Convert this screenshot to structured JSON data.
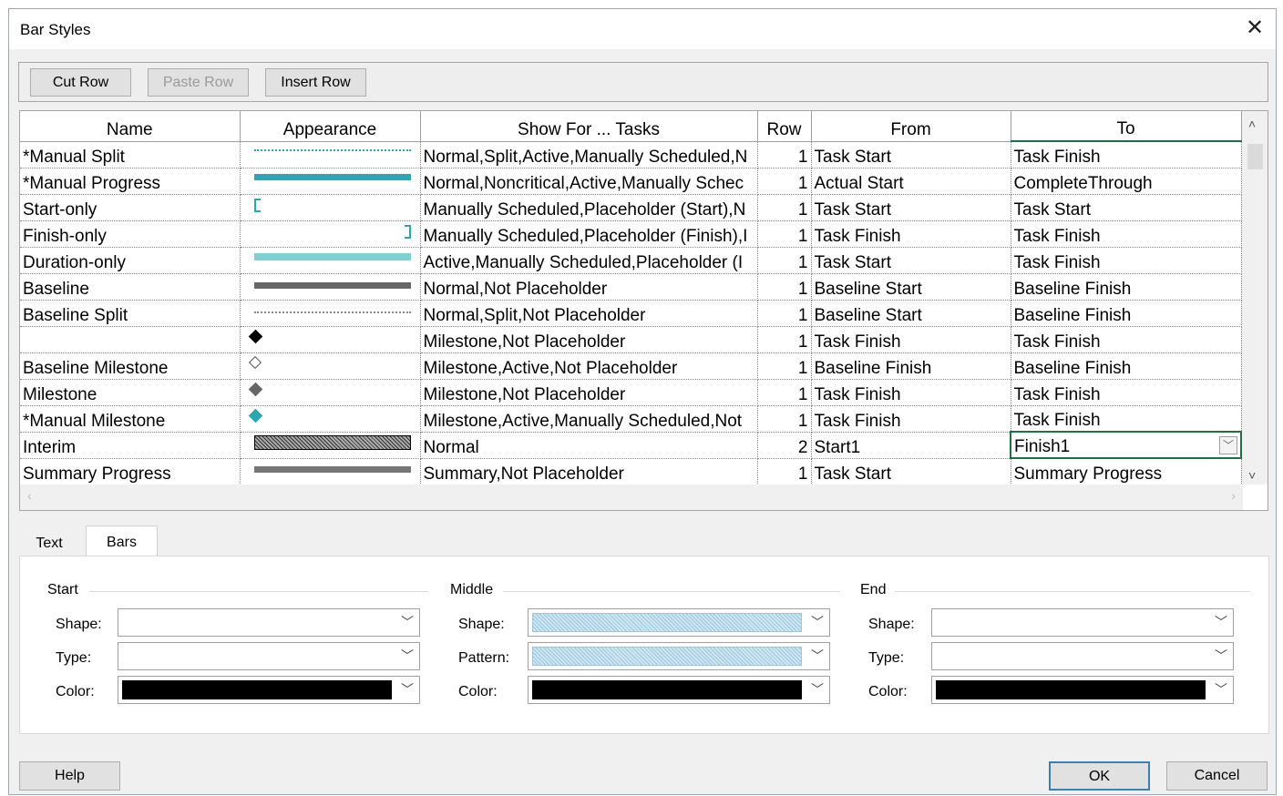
{
  "dialog": {
    "title": "Bar Styles"
  },
  "toolbar": {
    "cut": "Cut Row",
    "paste": "Paste Row",
    "insert": "Insert Row"
  },
  "columns": [
    "Name",
    "Appearance",
    "Show For ... Tasks",
    "Row",
    "From",
    "To"
  ],
  "rows": [
    {
      "name": "*Manual Split",
      "show": "Normal,Split,Active,Manually Scheduled,N",
      "row": "1",
      "from": "Task Start",
      "to": "Task Finish",
      "appearance": "dotted-teal"
    },
    {
      "name": "*Manual Progress",
      "show": "Normal,Noncritical,Active,Manually Schec",
      "row": "1",
      "from": "Actual Start",
      "to": "CompleteThrough",
      "appearance": "thin-teal-bar"
    },
    {
      "name": "Start-only",
      "show": "Manually Scheduled,Placeholder (Start),N",
      "row": "1",
      "from": "Task Start",
      "to": "Task Start",
      "appearance": "start-bracket"
    },
    {
      "name": "Finish-only",
      "show": "Manually Scheduled,Placeholder (Finish),I",
      "row": "1",
      "from": "Task Finish",
      "to": "Task Finish",
      "appearance": "finish-bracket"
    },
    {
      "name": "Duration-only",
      "show": "Active,Manually Scheduled,Placeholder (I",
      "row": "1",
      "from": "Task Start",
      "to": "Task Finish",
      "appearance": "light-teal-bar"
    },
    {
      "name": "Baseline",
      "show": "Normal,Not Placeholder",
      "row": "1",
      "from": "Baseline Start",
      "to": "Baseline Finish",
      "appearance": "gray-bar"
    },
    {
      "name": "Baseline Split",
      "show": "Normal,Split,Not Placeholder",
      "row": "1",
      "from": "Baseline Start",
      "to": "Baseline Finish",
      "appearance": "dotted-gray"
    },
    {
      "name": "",
      "show": "Milestone,Not Placeholder",
      "row": "1",
      "from": "Task Finish",
      "to": "Task Finish",
      "appearance": "black-diamond"
    },
    {
      "name": "Baseline Milestone",
      "show": "Milestone,Active,Not Placeholder",
      "row": "1",
      "from": "Baseline Finish",
      "to": "Baseline Finish",
      "appearance": "hollow-diamond"
    },
    {
      "name": "Milestone",
      "show": "Milestone,Not Placeholder",
      "row": "1",
      "from": "Task Finish",
      "to": "Task Finish",
      "appearance": "gray-diamond"
    },
    {
      "name": "*Manual Milestone",
      "show": "Milestone,Active,Manually Scheduled,Not",
      "row": "1",
      "from": "Task Finish",
      "to": "Task Finish",
      "appearance": "teal-diamond"
    },
    {
      "name": "Interim",
      "show": "Normal",
      "row": "2",
      "from": "Start1",
      "to": "Finish1",
      "appearance": "black-hatched-bar"
    },
    {
      "name": "Summary Progress",
      "show": "Summary,Not Placeholder",
      "row": "1",
      "from": "Task Start",
      "to": "Summary Progress",
      "appearance": "gray-thin-bar"
    }
  ],
  "tabs": {
    "text": "Text",
    "bars": "Bars"
  },
  "panel": {
    "start": {
      "label": "Start",
      "shape": "Shape:",
      "type": "Type:",
      "color": "Color:"
    },
    "middle": {
      "label": "Middle",
      "shape": "Shape:",
      "pattern": "Pattern:",
      "color": "Color:"
    },
    "end": {
      "label": "End",
      "shape": "Shape:",
      "type": "Type:",
      "color": "Color:"
    }
  },
  "buttons": {
    "help": "Help",
    "ok": "OK",
    "cancel": "Cancel"
  },
  "colors": {
    "teal": "#2aa7b0",
    "lightTeal": "#7fd0d6",
    "gray": "#666666",
    "accent": "#1e7145"
  }
}
